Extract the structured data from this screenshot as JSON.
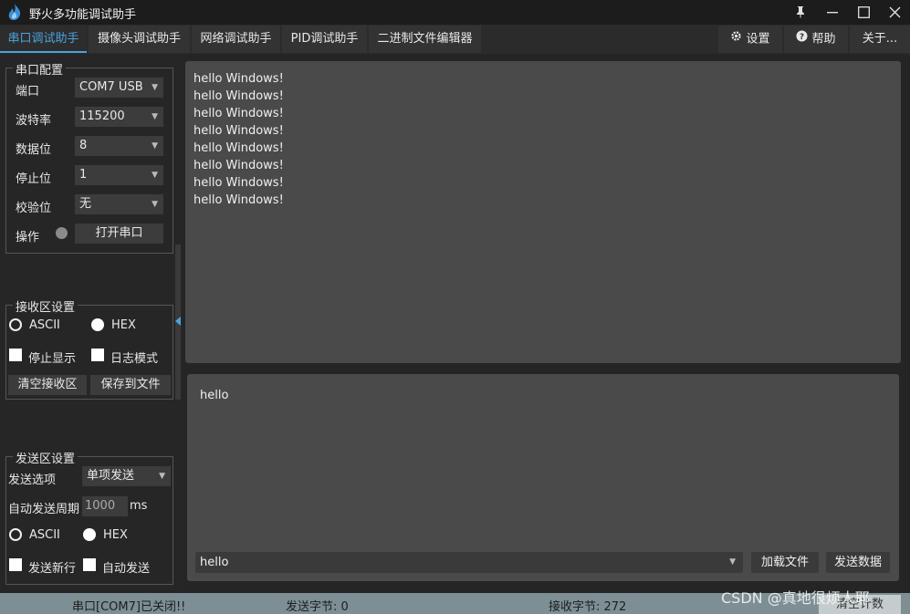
{
  "window": {
    "title": "野火多功能调试助手",
    "icon": "flame-icon",
    "controls": [
      "pin-icon",
      "minimize-icon",
      "maximize-icon",
      "close-icon"
    ]
  },
  "tabs": [
    {
      "label": "串口调试助手",
      "active": true
    },
    {
      "label": "摄像头调试助手",
      "active": false
    },
    {
      "label": "网络调试助手",
      "active": false
    },
    {
      "label": "PID调试助手",
      "active": false
    },
    {
      "label": "二进制文件编辑器",
      "active": false
    }
  ],
  "right_tabs": {
    "settings": {
      "label": "设置",
      "icon": "gear-icon"
    },
    "help": {
      "label": "帮助",
      "icon": "question-circle-icon"
    },
    "about": {
      "label": "关于..."
    }
  },
  "serial_config": {
    "title": "串口配置",
    "port_label": "端口",
    "port_value": "COM7 USB",
    "baud_label": "波特率",
    "baud_value": "115200",
    "databits_label": "数据位",
    "databits_value": "8",
    "stopbits_label": "停止位",
    "stopbits_value": "1",
    "parity_label": "校验位",
    "parity_value": "无",
    "op_label": "操作",
    "open_button": "打开串口",
    "led_color": "#8a8a8a"
  },
  "receive_settings": {
    "title": "接收区设置",
    "ascii_label": "ASCII",
    "hex_label": "HEX",
    "selected_format": "HEX",
    "stop_display_label": "停止显示",
    "log_mode_label": "日志模式",
    "clear_button": "清空接收区",
    "save_button": "保存到文件"
  },
  "send_settings": {
    "title": "发送区设置",
    "option_label": "发送选项",
    "option_value": "单项发送",
    "period_label": "自动发送周期",
    "period_value": "1000",
    "period_unit": "ms",
    "ascii_label": "ASCII",
    "hex_label": "HEX",
    "selected_format": "HEX",
    "newline_label": "发送新行",
    "auto_send_label": "自动发送"
  },
  "receive_area": {
    "lines": [
      "hello Windows!",
      "hello Windows!",
      "hello Windows!",
      "hello Windows!",
      "hello Windows!",
      "hello Windows!",
      "hello Windows!",
      "hello Windows!"
    ]
  },
  "send_area": {
    "text": "hello",
    "history_value": "hello",
    "load_file_button": "加载文件",
    "send_button": "发送数据"
  },
  "status": {
    "port_status": "串口[COM7]已关闭!!",
    "sent_bytes": "发送字节: 0",
    "recv_bytes": "接收字节: 272",
    "clear_count_button": "清空计数"
  },
  "watermark": "CSDN @真地很烦人耶",
  "colors": {
    "accent": "#4aa3df",
    "background": "#252525",
    "panel": "#4a4a4a",
    "statusbar": "#7d8f94"
  }
}
